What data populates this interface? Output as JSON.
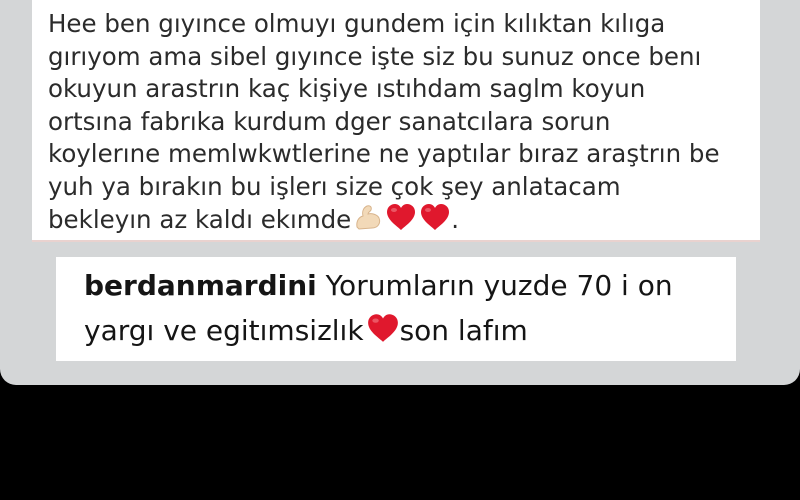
{
  "post": {
    "lines": [
      "Hee ben gıyınce olmuyı gundem için kılıktan kılıga",
      "gırıyom ama sibel gıyınce işte siz bu sunuz once benı",
      "okuyun arastrın kaç kişiye ıstıhdam saglm koyun",
      "ortsına fabrıka kurdum dger sanatcılara sorun",
      "koylerıne memlwkwtlerine ne yaptılar bıraz araştrın be",
      "yuh ya bırakın bu işlerı size çok şey anlatacam",
      "bekleyın az kaldı ekımde"
    ],
    "trailing": ".",
    "emojis": [
      "flexed-biceps-icon",
      "red-heart-icon",
      "red-heart-icon"
    ]
  },
  "comment": {
    "username": "berdanmardini",
    "text_line1": "Yorumların yuzde 70 i on",
    "text_line2": "yargı ve egitımsizlık",
    "text_line2_after": "son lafım",
    "emoji": "red-heart-icon"
  },
  "colors": {
    "background": "#000000",
    "panel": "#d4d6d7",
    "bubble": "#ffffff",
    "heart": "#e0182d"
  }
}
